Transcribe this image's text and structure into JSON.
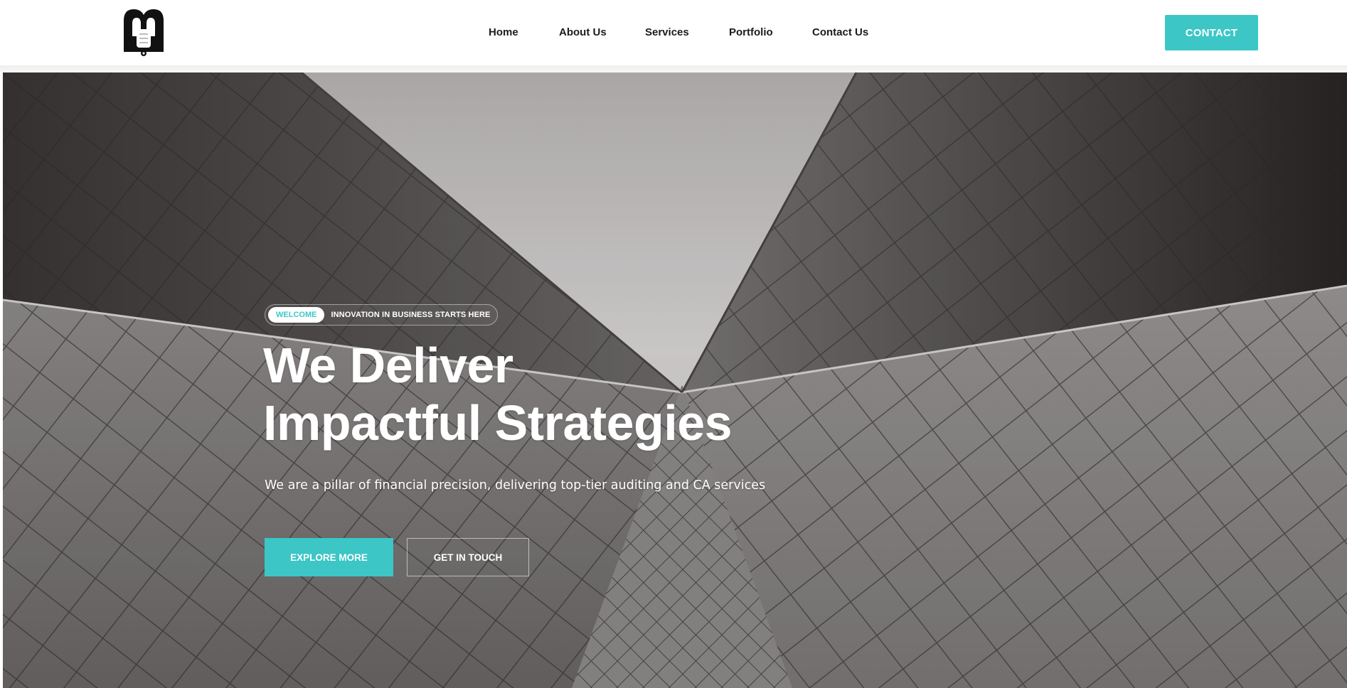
{
  "header": {
    "logo_icon": "mh-monogram-logo",
    "nav": {
      "home": "Home",
      "about": "About Us",
      "services": "Services",
      "portfolio": "Portfolio",
      "contact": "Contact Us"
    },
    "contact_button": "CONTACT"
  },
  "hero": {
    "badge_pill": "WELCOME",
    "badge_text": "INNOVATION IN BUSINESS STARTS HERE",
    "title_line1": "We Deliver",
    "title_line2": "Impactful Strategies",
    "subtitle": "We are a pillar of financial precision, delivering top-tier auditing and CA services",
    "explore_button": "EXPLORE MORE",
    "touch_button": "GET IN TOUCH",
    "background": "black-and-white low-angle photo of glass skyscrapers"
  },
  "colors": {
    "accent": "#3cc6c6",
    "nav_text": "#1c1c1c",
    "hero_text": "#ffffff"
  }
}
